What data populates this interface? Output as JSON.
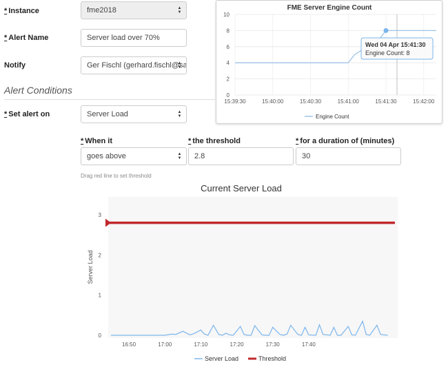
{
  "form": {
    "instance_label": "Instance",
    "instance_value": "fme2018",
    "alert_name_label": "Alert Name",
    "alert_name_value": "Server load over 70%",
    "notify_label": "Notify",
    "notify_value": "Ger Fischl (gerhard.fischl@safe",
    "required_mark": "*",
    "section_title": "Alert Conditions",
    "set_alert_label": "Set alert on",
    "set_alert_value": "Server Load",
    "when_label": "When it",
    "when_value": "goes above",
    "threshold_label": "the threshold",
    "threshold_value": "2.8",
    "duration_label": "for a duration of (minutes)",
    "duration_value": "30",
    "drag_hint": "Drag red line to set threshold"
  },
  "engine_chart": {
    "title": "FME Server Engine Count",
    "tooltip_date": "Wed 04 Apr 15:41:30",
    "tooltip_value": "Engine Count: 8",
    "legend": "Engine Count",
    "line_color": "#9dc3e6",
    "marker_color": "#7cb5ec"
  },
  "load_chart": {
    "title": "Current Server Load",
    "ylabel": "Server Load",
    "legend_series": "Server Load",
    "legend_threshold": "Threshold",
    "series_color": "#7cb5ec",
    "threshold_color": "#c0282d",
    "plot_bg": "#f7f7f7"
  },
  "chart_data": [
    {
      "type": "line",
      "title": "FME Server Engine Count",
      "xlabel": "",
      "ylabel": "",
      "x_ticks": [
        "15:39:30",
        "15:40:00",
        "15:40:30",
        "15:41:00",
        "15:41:30",
        "15:42:00"
      ],
      "y_ticks": [
        0,
        2,
        4,
        6,
        8,
        10
      ],
      "ylim": [
        0,
        10
      ],
      "grid": true,
      "legend_position": "bottom",
      "series": [
        {
          "name": "Engine Count",
          "points": [
            [
              "15:39:30",
              4
            ],
            [
              "15:41:00",
              4
            ],
            [
              "15:41:05",
              5
            ],
            [
              "15:41:15",
              6
            ],
            [
              "15:41:25",
              7
            ],
            [
              "15:41:30",
              8
            ],
            [
              "15:42:00",
              8
            ],
            [
              "15:42:10",
              8
            ]
          ]
        }
      ],
      "tooltip": {
        "x": "15:41:30",
        "y": 8
      }
    },
    {
      "type": "line",
      "title": "Current Server Load",
      "xlabel": "",
      "ylabel": "Server Load",
      "x_ticks": [
        "16:50",
        "17:00",
        "17:10",
        "17:20",
        "17:30",
        "17:40"
      ],
      "y_ticks": [
        0,
        1,
        2,
        3
      ],
      "ylim": [
        0,
        3
      ],
      "grid": false,
      "legend_position": "bottom",
      "threshold": 2.8,
      "series": [
        {
          "name": "Server Load",
          "x_minutes_after_1645": [
            0,
            15,
            17,
            18,
            20,
            22,
            23,
            25,
            26,
            27,
            28.5,
            30,
            31,
            32,
            33,
            34,
            36,
            37,
            38,
            39,
            40,
            42,
            43,
            44,
            45,
            47,
            48,
            49,
            50,
            52,
            53,
            54,
            55,
            57,
            58,
            59,
            61,
            62,
            63,
            64,
            66,
            67,
            68,
            70,
            71,
            72,
            74,
            75,
            77
          ],
          "values": [
            0,
            0,
            0.03,
            0.02,
            0.1,
            0.01,
            0.04,
            0.13,
            0.03,
            0.0,
            0.25,
            0.02,
            0.0,
            0.05,
            0.01,
            0.0,
            0.22,
            0.02,
            0.0,
            0.0,
            0.24,
            0.01,
            0.0,
            0.0,
            0.2,
            0.02,
            0.0,
            0.03,
            0.25,
            0.02,
            0.0,
            0.2,
            0.01,
            0.0,
            0.26,
            0.02,
            0.0,
            0.2,
            0.0,
            0.0,
            0.22,
            0.01,
            0.0,
            0.35,
            0.02,
            0.0,
            0.25,
            0.02,
            0.0
          ]
        },
        {
          "name": "Threshold",
          "values": [
            2.8
          ]
        }
      ]
    }
  ]
}
